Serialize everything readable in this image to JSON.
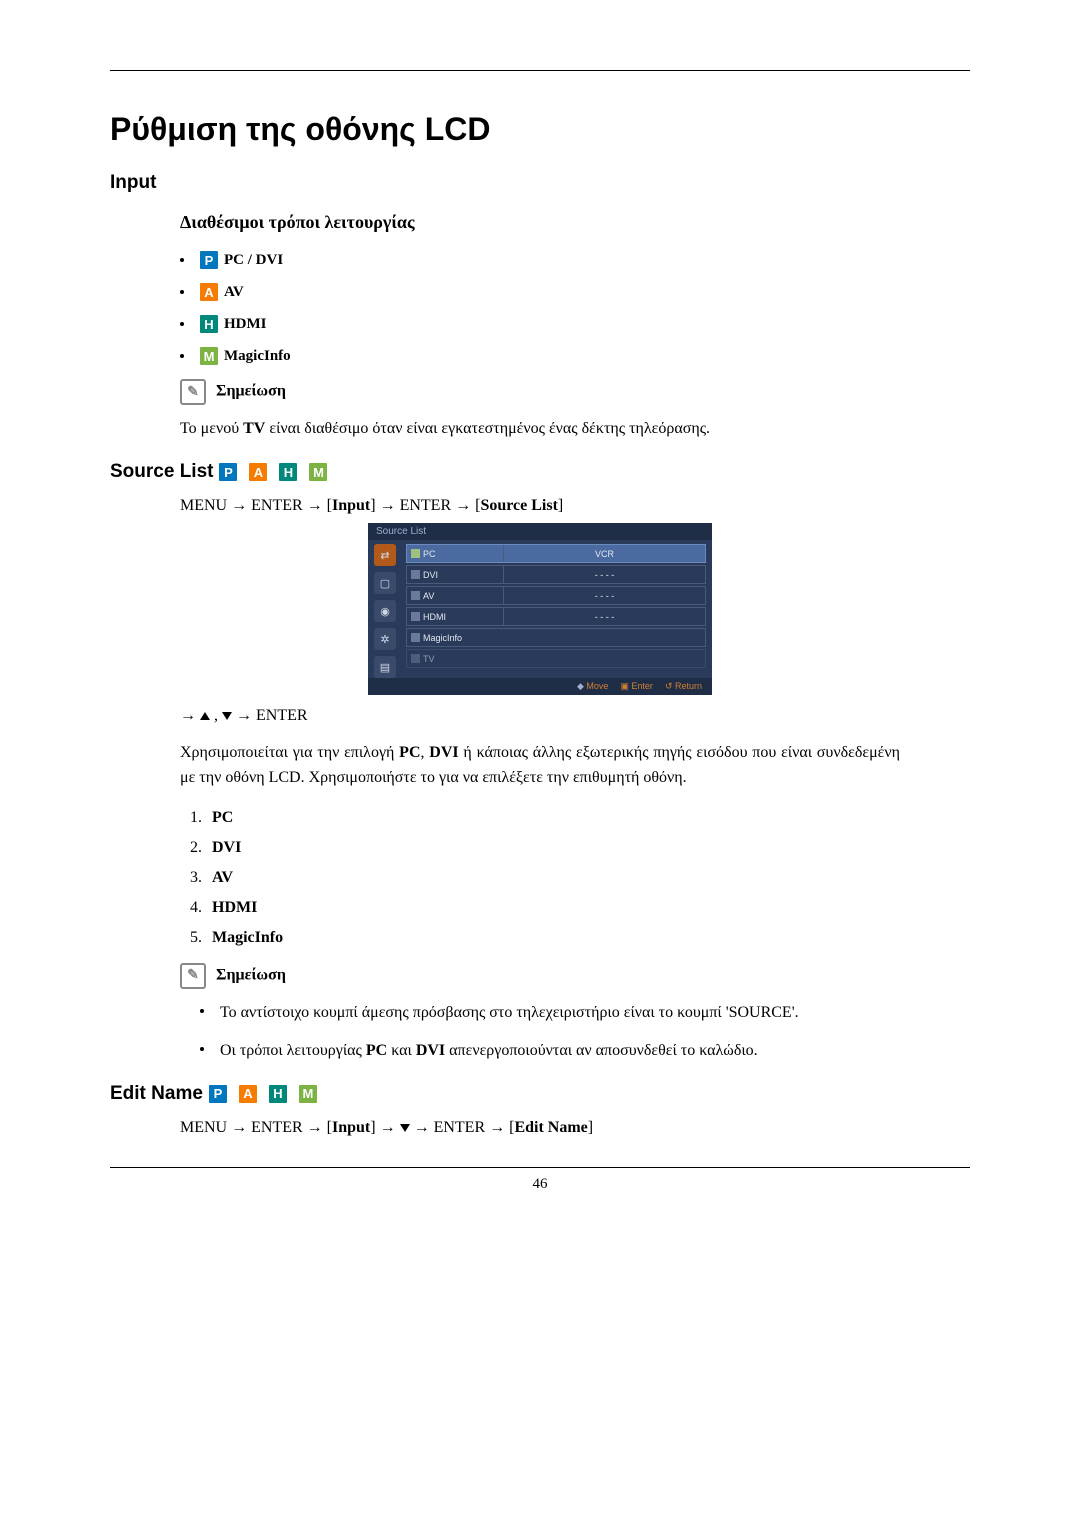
{
  "title": "Ρύθμιση της οθόνης LCD",
  "input_heading": "Input",
  "modes_heading": "Διαθέσιμοι τρόποι λειτουργίας",
  "modes": {
    "pc": "PC / DVI",
    "av": "AV",
    "hdmi": "HDMI",
    "magic": "MagicInfo"
  },
  "note_label": "Σημείωση",
  "note1_text_pre": "Το μενού ",
  "note1_text_bold": "TV",
  "note1_text_post": " είναι διαθέσιμο όταν είναι εγκατεστημένος ένας δέκτης τηλεόρασης.",
  "source_list_heading": "Source List",
  "source_path": {
    "p1": "MENU → ENTER → [",
    "b1": "Input",
    "p2": "] → ENTER → [",
    "b2": "Source List",
    "p3": "]"
  },
  "osd": {
    "header": "Source List",
    "rows": [
      {
        "label": "PC",
        "value": "VCR",
        "selected": true,
        "check": "on"
      },
      {
        "label": "DVI",
        "value": "- - - -",
        "check": "off"
      },
      {
        "label": "AV",
        "value": "- - - -",
        "check": "off"
      },
      {
        "label": "HDMI",
        "value": "- - - -",
        "check": "off"
      },
      {
        "label": "MagicInfo",
        "value": "",
        "check": "off"
      },
      {
        "label": "TV",
        "value": "",
        "disabled": true,
        "check": "off"
      }
    ],
    "footer": {
      "move": "Move",
      "enter": "Enter",
      "return": "Return"
    }
  },
  "nav_enter": " → ENTER",
  "source_desc_p1": "Χρησιμοποιείται για την επιλογή ",
  "source_desc_b1": "PC",
  "source_desc_p2": ", ",
  "source_desc_b2": "DVI",
  "source_desc_p3": " ή κάποιας άλλης εξωτερικής πηγής εισόδου που είναι συνδεδεμένη με την οθόνη LCD. Χρησιμοποιήστε το για να επιλέξετε την επιθυμητή οθόνη.",
  "list": {
    "i1": "PC",
    "i2": "DVI",
    "i3": "AV",
    "i4": "HDMI",
    "i5": "MagicInfo"
  },
  "note2_items": {
    "n1": "Το αντίστοιχο κουμπί άμεσης πρόσβασης στο τηλεχειριστήριο είναι το κουμπί 'SOURCE'.",
    "n2_p1": "Οι τρόποι λειτουργίας ",
    "n2_b1": "PC",
    "n2_p2": " και ",
    "n2_b2": "DVI",
    "n2_p3": " απενεργοποιούνται αν αποσυνδεθεί το καλώδιο."
  },
  "edit_name_heading": "Edit Name",
  "edit_path": {
    "p1": "MENU → ENTER → [",
    "b1": "Input",
    "p2": "] → ",
    "p3": " → ENTER → [",
    "b2": "Edit Name",
    "p4": "]"
  },
  "page_number": "46"
}
